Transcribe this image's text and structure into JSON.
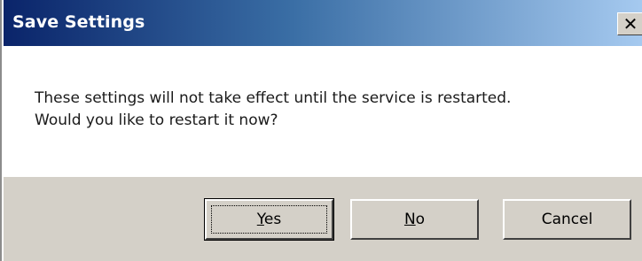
{
  "window": {
    "title": "Save Settings",
    "close_glyph": "✕"
  },
  "message": {
    "line1": "These settings will not take effect until the service is restarted.",
    "line2": "Would you like to restart it now?"
  },
  "buttons": {
    "yes": {
      "mnemonic": "Y",
      "rest": "es"
    },
    "no": {
      "mnemonic": "N",
      "rest": "o"
    },
    "cancel": {
      "label": "Cancel"
    }
  },
  "colors": {
    "titlebar_start": "#0a246a",
    "titlebar_end": "#a6caf0",
    "button_face": "#d4d0c8"
  }
}
